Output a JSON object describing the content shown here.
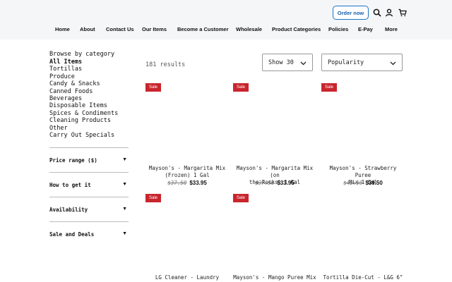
{
  "header": {
    "order_now": "Order now",
    "icons": [
      "search-icon",
      "user-icon",
      "cart-icon"
    ],
    "nav": [
      "Home",
      "About",
      "Contact Us",
      "Our Items",
      "Become a Customer",
      "Wholesale",
      "Product Categories",
      "Policies",
      "E-Pay",
      "More"
    ]
  },
  "sidebar": {
    "browse_title": "Browse by category",
    "categories": [
      "All Items",
      "Tortillas",
      "Produce",
      "Candy & Snacks",
      "Canned Foods",
      "Beverages",
      "Disposable Items",
      "Spices & Condiments",
      "Cleaning Products",
      "Other",
      "Carry Out Specials"
    ],
    "active_category": "All Items",
    "filters": [
      "Price range ($)",
      "How to get it",
      "Availability",
      "Sale and Deals"
    ]
  },
  "toolbar": {
    "results": "181 results",
    "show": "Show 30",
    "sort": "Popularity"
  },
  "products": [
    {
      "badge": "Sale",
      "name_line1": "Mayson's - Margarita Mix",
      "name_line2": "(Frozen) 1 Gal",
      "old_price": "$37.50",
      "price": "$33.95"
    },
    {
      "badge": "Sale",
      "name_line1": "Mayson's - Margarita Mix (on",
      "name_line2": "the Rocks) 1 Gal",
      "old_price": "$37.50",
      "price": "$33.95"
    },
    {
      "badge": "Sale",
      "name_line1": "Mayson's - Strawberry Puree",
      "name_line2": "Mix 1 Gal",
      "old_price": "$42.50",
      "price": "$39.50"
    },
    {
      "badge": "Sale",
      "name_line1": "LG Cleaner - Laundry",
      "name_line2": "",
      "old_price": "",
      "price": ""
    },
    {
      "badge": "Sale",
      "name_line1": "Mayson's - Mango Puree Mix 1",
      "name_line2": "",
      "old_price": "",
      "price": ""
    },
    {
      "badge": "",
      "name_line1": "Tortilla Die-Cut - L&G 6\"",
      "name_line2": "",
      "old_price": "",
      "price": ""
    }
  ]
}
